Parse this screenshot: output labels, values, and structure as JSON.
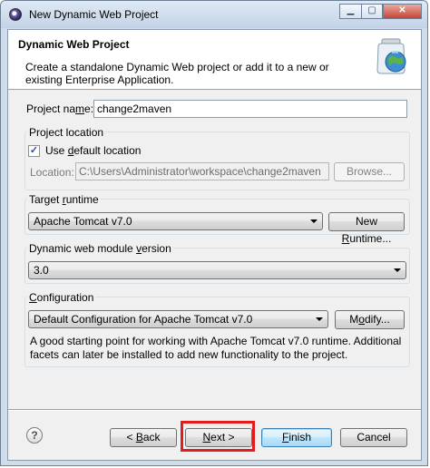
{
  "window": {
    "title": "New Dynamic Web Project",
    "controls": {
      "minimize": "▁",
      "maximize": "▢",
      "close": "✕"
    }
  },
  "header": {
    "title": "Dynamic Web Project",
    "description": "Create a standalone Dynamic Web project or add it to a new or existing Enterprise Application.",
    "icon": "web-project-globe-jar-icon"
  },
  "project_name": {
    "label_pre": "Project na",
    "label_mnemonic": "m",
    "label_post": "e:",
    "value": "change2maven"
  },
  "project_location": {
    "group_label": "Project location",
    "use_default_pre": "Use ",
    "use_default_mnemonic": "d",
    "use_default_post": "efault location",
    "use_default_checked": true,
    "location_label": "Location:",
    "location_value": "C:\\Users\\Administrator\\workspace\\change2maven",
    "browse_label": "Browse..."
  },
  "target_runtime": {
    "group_label_pre": "Target ",
    "group_label_mnemonic": "r",
    "group_label_post": "untime",
    "selected": "Apache Tomcat v7.0",
    "new_runtime_pre": "New ",
    "new_runtime_mnemonic": "R",
    "new_runtime_post": "untime..."
  },
  "module_version": {
    "group_label_pre": "Dynamic web module ",
    "group_label_mnemonic": "v",
    "group_label_post": "ersion",
    "selected": "3.0"
  },
  "configuration": {
    "group_label_pre": "",
    "group_label_mnemonic": "C",
    "group_label_post": "onfiguration",
    "selected": "Default Configuration for Apache Tomcat v7.0",
    "modify_pre": "M",
    "modify_mnemonic": "o",
    "modify_post": "dify...",
    "description": "A good starting point for working with Apache Tomcat v7.0 runtime. Additional facets can later be installed to add new functionality to the project."
  },
  "footer": {
    "help_symbol": "?",
    "back_pre": "< ",
    "back_mnemonic": "B",
    "back_post": "ack",
    "next_mnemonic": "N",
    "next_post": "ext >",
    "finish_mnemonic": "F",
    "finish_post": "inish",
    "cancel_label": "Cancel"
  },
  "colors": {
    "highlight": "#e21c1c",
    "window_frame": "#cfdcea",
    "default_button": "#bee6fd"
  }
}
